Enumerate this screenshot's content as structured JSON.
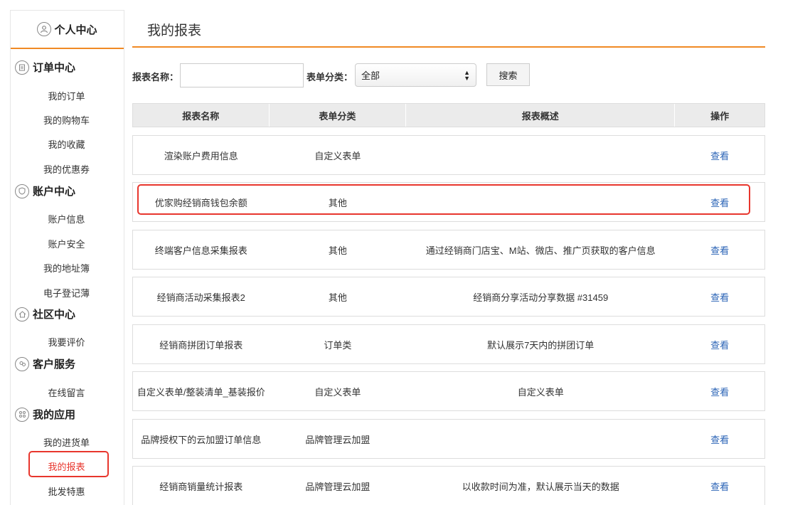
{
  "sidebar": {
    "top": {
      "label": "个人中心",
      "icon": "user-icon"
    },
    "groups": [
      {
        "label": "订单中心",
        "icon": "order-icon",
        "items": [
          "我的订单",
          "我的购物车",
          "我的收藏",
          "我的优惠券"
        ]
      },
      {
        "label": "账户中心",
        "icon": "shield-icon",
        "items": [
          "账户信息",
          "账户安全",
          "我的地址簿",
          "电子登记薄"
        ]
      },
      {
        "label": "社区中心",
        "icon": "home-icon",
        "items": [
          "我要评价"
        ]
      },
      {
        "label": "客户服务",
        "icon": "service-icon",
        "items": [
          "在线留言"
        ]
      },
      {
        "label": "我的应用",
        "icon": "apps-icon",
        "items": [
          "我的进货单",
          "我的报表",
          "批发特惠"
        ]
      }
    ],
    "active_item": "我的报表"
  },
  "page": {
    "title": "我的报表"
  },
  "filters": {
    "name_label": "报表名称：",
    "name_value": "",
    "category_label": "表单分类：",
    "category_selected": "全部",
    "search_button": "搜索"
  },
  "table": {
    "headers": [
      "报表名称",
      "表单分类",
      "报表概述",
      "操作"
    ],
    "rows": [
      {
        "name": "渲染账户费用信息",
        "category": "自定义表单",
        "summary": "",
        "action": "查看"
      },
      {
        "name": "优家购经销商钱包余额",
        "category": "其他",
        "summary": "",
        "action": "查看"
      },
      {
        "name": "终端客户信息采集报表",
        "category": "其他",
        "summary": "通过经销商门店宝、M站、微店、推广页获取的客户信息",
        "action": "查看"
      },
      {
        "name": "经销商活动采集报表2",
        "category": "其他",
        "summary": "经销商分享活动分享数据 #31459",
        "action": "查看"
      },
      {
        "name": "经销商拼团订单报表",
        "category": "订单类",
        "summary": "默认展示7天内的拼团订单",
        "action": "查看"
      },
      {
        "name": "自定义表单/整装清单_基装报价",
        "category": "自定义表单",
        "summary": "自定义表单",
        "action": "查看"
      },
      {
        "name": "品牌授权下的云加盟订单信息",
        "category": "品牌管理云加盟",
        "summary": "",
        "action": "查看"
      },
      {
        "name": "经销商销量统计报表",
        "category": "品牌管理云加盟",
        "summary": "以收款时间为准，默认展示当天的数据",
        "action": "查看"
      }
    ]
  },
  "colors": {
    "accent": "#f08a24",
    "highlight": "#e8362d",
    "link": "#2a63b6"
  }
}
